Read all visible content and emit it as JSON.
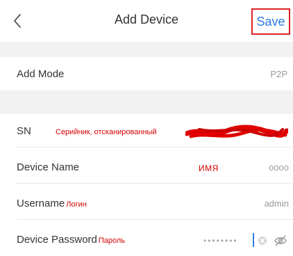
{
  "header": {
    "title": "Add Device",
    "save_label": "Save",
    "back_icon": "chevron-left-icon"
  },
  "rows": {
    "add_mode": {
      "label": "Add Mode",
      "value": "P2P"
    },
    "sn": {
      "label": "SN",
      "annotation": "Серийник, отсканированный",
      "redacted": true
    },
    "device_name": {
      "label": "Device Name",
      "annotation": "ИМЯ",
      "value": "oooo"
    },
    "username": {
      "label": "Username",
      "annotation": "Логин",
      "value": "admin"
    },
    "password": {
      "label": "Device Password",
      "annotation": "Пароль",
      "masked_value": "••••••••"
    }
  },
  "colors": {
    "accent": "#2c7be5",
    "annotation": "#d40000",
    "section_gap": "#f2f2f2",
    "highlight_box": "#e02020"
  },
  "icons": {
    "clear": "clear-input-icon",
    "visibility": "eye-hidden-icon"
  }
}
